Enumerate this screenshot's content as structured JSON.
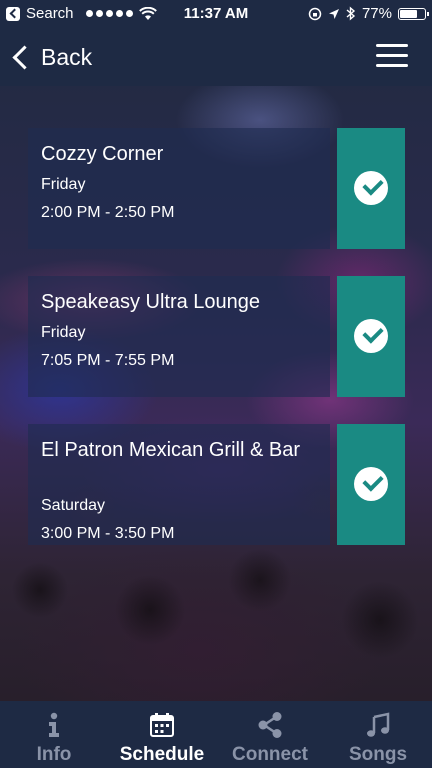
{
  "status_bar": {
    "carrier": "Search",
    "time": "11:37 AM",
    "battery": "77%",
    "battery_level": 0.77
  },
  "nav": {
    "back_label": "Back"
  },
  "schedule": [
    {
      "venue": "Cozzy Corner",
      "day": "Friday",
      "time": "2:00 PM - 2:50 PM"
    },
    {
      "venue": "Speakeasy Ultra Lounge",
      "day": "Friday",
      "time": "7:05 PM - 7:55 PM"
    },
    {
      "venue": "El Patron Mexican Grill & Bar",
      "day": "Saturday",
      "time": "3:00 PM - 3:50 PM"
    }
  ],
  "tabs": [
    {
      "label": "Info",
      "icon": "info-icon"
    },
    {
      "label": "Schedule",
      "icon": "calendar-icon",
      "active": true
    },
    {
      "label": "Connect",
      "icon": "share-icon"
    },
    {
      "label": "Songs",
      "icon": "music-note-icon"
    }
  ],
  "colors": {
    "bar_background": "#1e2a44",
    "check_tile": "#1a8a83",
    "inactive_tab": "#8a93a8"
  }
}
